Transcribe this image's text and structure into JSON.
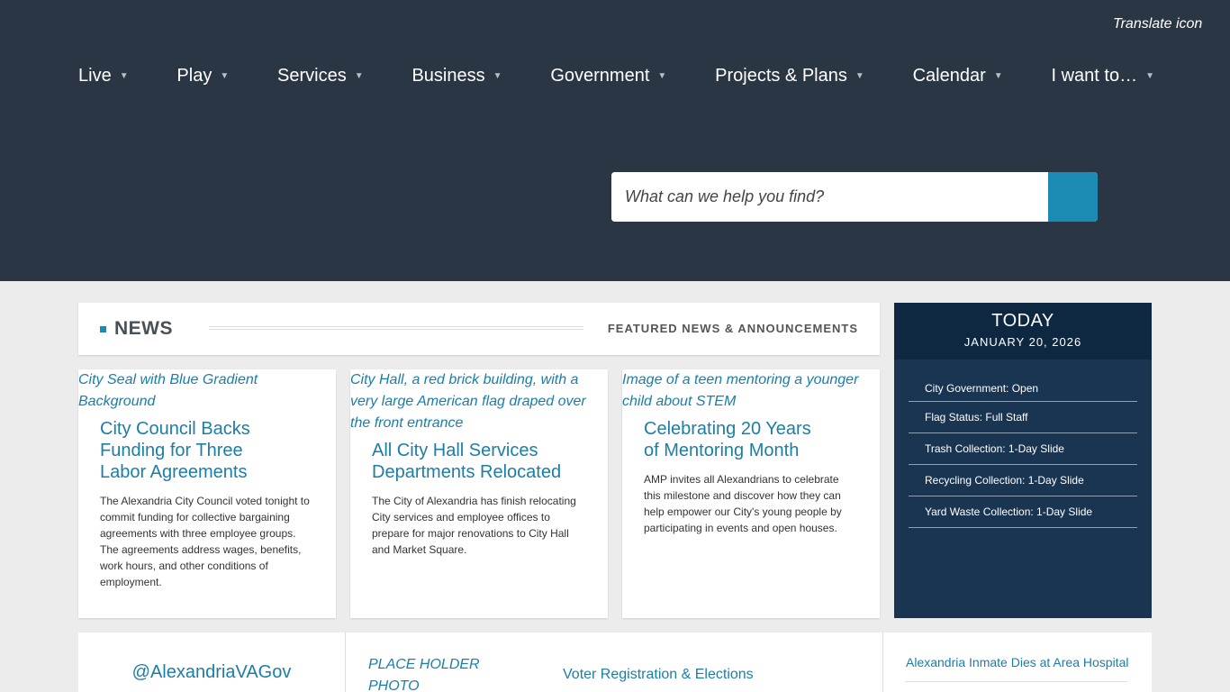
{
  "header": {
    "translate_alt": "Translate icon",
    "nav": [
      {
        "label": "Live"
      },
      {
        "label": "Play"
      },
      {
        "label": "Services"
      },
      {
        "label": "Business"
      },
      {
        "label": "Government"
      },
      {
        "label": "Projects & Plans"
      },
      {
        "label": "Calendar"
      },
      {
        "label": "I want to…"
      }
    ],
    "caret": "▼",
    "search": {
      "placeholder": "What can we help you find?"
    }
  },
  "news": {
    "title": "NEWS",
    "subtitle": "FEATURED NEWS & ANNOUNCEMENTS",
    "cards": [
      {
        "image_alt": "City Seal with Blue Gradient Background",
        "title": "City Council Backs Funding for Three Labor Agreements",
        "text": "The Alexandria City Council voted tonight to commit funding for collective bargaining agreements with three employee groups. The agreements address wages, benefits, work hours, and other conditions of employment."
      },
      {
        "image_alt": "City Hall, a red brick building, with a very large American flag draped over the front entrance",
        "title": "All City Hall Services Departments Relocated",
        "text": "The City of Alexandria has finish relocating City services and employee offices to prepare for major renovations to City Hall and Market Square."
      },
      {
        "image_alt": "Image of a teen mentoring a younger child about STEM",
        "title": "Celebrating 20 Years of Mentoring Month",
        "text": "AMP invites all Alexandrians to celebrate this milestone and discover how they can help empower our City's young people by participating in events and open houses."
      }
    ]
  },
  "today": {
    "title": "TODAY",
    "date": "JANUARY 20, 2026",
    "items": [
      "City Government: Open",
      "Flag Status: Full Staff",
      "Trash Collection: 1-Day Slide",
      "Recycling Collection: 1-Day Slide",
      "Yard Waste Collection: 1-Day Slide"
    ]
  },
  "bottom": {
    "twitter_handle": "@AlexandriaVAGov",
    "placeholder_alt": "PLACE HOLDER PHOTO",
    "voter_link": "Voter Registration & Elections",
    "inmate_link": "Alexandria Inmate Dies at Area Hospital"
  },
  "colors": {
    "header_bg": "#2b3644",
    "accent": "#1b8bb4",
    "link": "#1b7ea8",
    "today_bg": "#193551",
    "today_head_bg": "#0e2841"
  }
}
